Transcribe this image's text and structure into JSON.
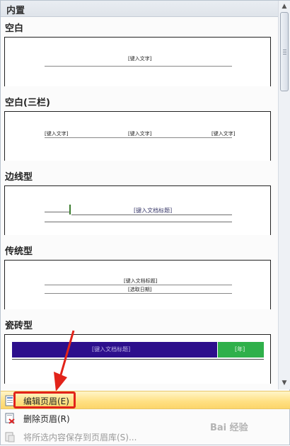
{
  "gallery": {
    "section_title": "内置",
    "items": [
      {
        "label": "空白",
        "placeholders": [
          "[键入文字]"
        ]
      },
      {
        "label": "空白(三栏)",
        "placeholders": [
          "[键入文字]",
          "[键入文字]",
          "[键入文字]"
        ]
      },
      {
        "label": "边线型",
        "placeholders": [
          "[键入文档标题]"
        ]
      },
      {
        "label": "传统型",
        "placeholders": [
          "[键入文档标题]",
          "[选取日期]"
        ]
      },
      {
        "label": "瓷砖型",
        "placeholders": [
          "[键入文档标题]",
          "[年]"
        ]
      }
    ]
  },
  "menu": {
    "items": [
      {
        "label": "编辑页眉(E)",
        "state": "highlighted"
      },
      {
        "label": "删除页眉(R)",
        "state": "normal"
      },
      {
        "label": "将所选内容保存到页眉库(S)...",
        "state": "disabled"
      }
    ]
  },
  "watermark": "Bai 经验",
  "colors": {
    "tile_title_bar": "#2d0f8c",
    "tile_year_box": "#2fb04a",
    "annotation_red": "#e2231a",
    "highlight": "#ffe082"
  }
}
